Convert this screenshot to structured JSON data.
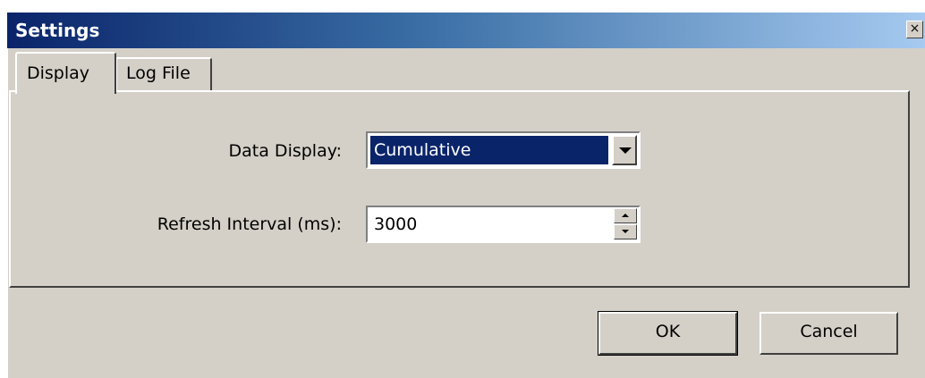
{
  "window": {
    "title": "Settings",
    "close_glyph": "×",
    "colors": {
      "titlebar_start": "#0a246a",
      "titlebar_end": "#a6caf0",
      "face": "#d4d0c8",
      "selection": "#0a246a"
    }
  },
  "tabs": [
    {
      "label": "Display",
      "selected": true
    },
    {
      "label": "Log File",
      "selected": false
    }
  ],
  "form": {
    "data_display": {
      "label": "Data Display:",
      "value": "Cumulative",
      "dropdown_icon": "chevron-down-icon"
    },
    "refresh_interval": {
      "label": "Refresh Interval (ms):",
      "value": "3000",
      "spinner_icons": [
        "spin-up-icon",
        "spin-down-icon"
      ]
    }
  },
  "buttons": {
    "ok": "OK",
    "cancel": "Cancel"
  }
}
